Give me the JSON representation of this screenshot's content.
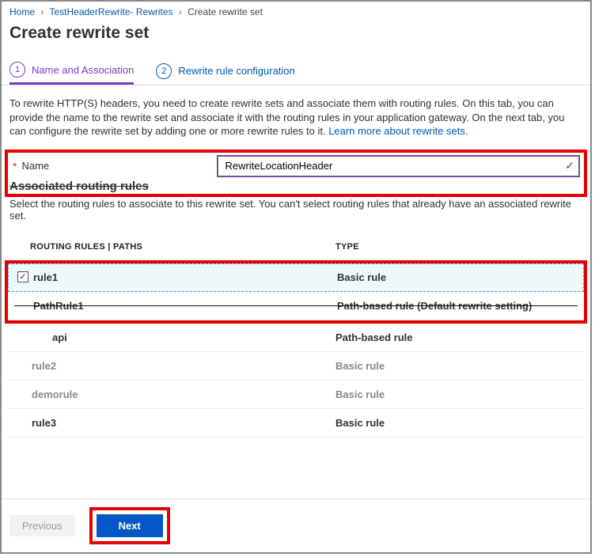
{
  "breadcrumb": {
    "home": "Home",
    "mid": "TestHeaderRewrite- Rewrites",
    "current": "Create rewrite set"
  },
  "title": "Create rewrite set",
  "tabs": {
    "t1_num": "1",
    "t1_label": "Name and Association",
    "t2_num": "2",
    "t2_label": "Rewrite rule configuration"
  },
  "description": "To rewrite HTTP(S) headers, you need to create rewrite sets and associate them with routing rules. On this tab, you can provide the name to the rewrite set and associate it with the routing rules in your application gateway. On the next tab, you can configure the rewrite set by adding one or more rewrite rules to it.  ",
  "learn_more": "Learn more about rewrite sets.",
  "name_label": "Name",
  "name_value": "RewriteLocationHeader",
  "assoc_heading": "Associated routing rules",
  "assoc_desc": "Select the routing rules to associate to this rewrite set. You can't select routing rules that already have an associated rewrite set.",
  "columns": {
    "c1": "ROUTING RULES | PATHS",
    "c2": "TYPE"
  },
  "rows": [
    {
      "name": "rule1",
      "type": "Basic rule",
      "checked": true
    },
    {
      "name": "PathRule1",
      "type": "Path-based rule (Default rewrite setting)",
      "strike": true
    },
    {
      "name": "api",
      "type": "Path-based rule",
      "indent": true
    },
    {
      "name": "rule2",
      "type": "Basic rule",
      "disabled": true
    },
    {
      "name": "demorule",
      "type": "Basic rule",
      "disabled": true
    },
    {
      "name": "rule3",
      "type": "Basic rule"
    }
  ],
  "buttons": {
    "prev": "Previous",
    "next": "Next"
  }
}
